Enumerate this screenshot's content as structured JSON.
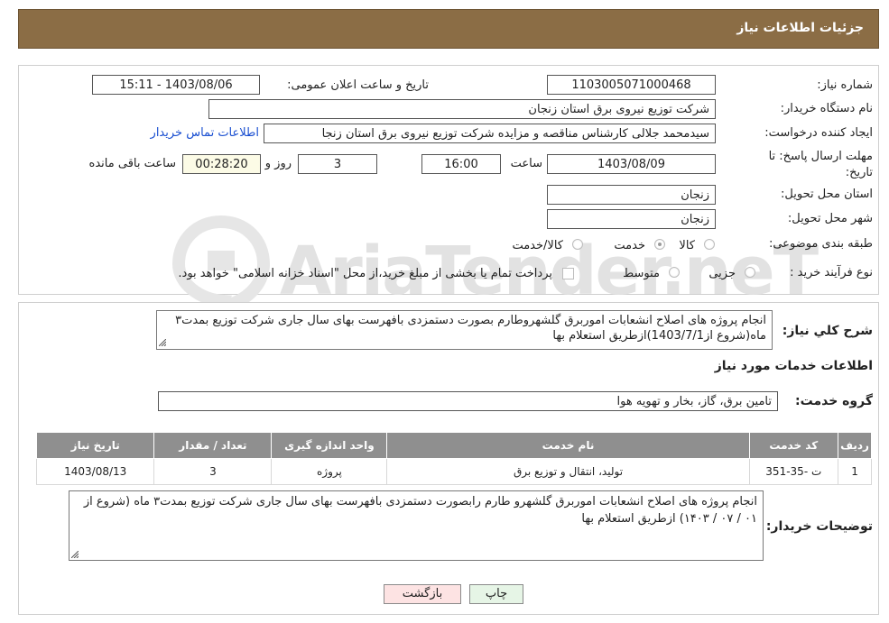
{
  "header": {
    "title": "جزئیات اطلاعات نیاز"
  },
  "fields": {
    "need_number_label": "شماره نیاز:",
    "need_number": "1103005071000468",
    "announce_label": "تاریخ و ساعت اعلان عمومی:",
    "announce_value": "1403/08/06 - 15:11",
    "buyer_org_label": "نام دستگاه خریدار:",
    "buyer_org": "شرکت توزیع نیروی برق استان زنجان",
    "creator_label": "ایجاد کننده درخواست:",
    "creator": "سیدمحمد جلالی کارشناس مناقصه و مزایده شرکت توزیع نیروی برق استان زنجا",
    "contact_link": "اطلاعات تماس خریدار",
    "deadline_label_1": "مهلت ارسال پاسخ: تا",
    "deadline_label_2": "تاریخ:",
    "deadline_date": "1403/08/09",
    "time_label": "ساعت",
    "deadline_time": "16:00",
    "days": "3",
    "days_label": "روز و",
    "remaining": "00:28:20",
    "remaining_label": "ساعت باقی مانده",
    "province_label": "استان محل تحویل:",
    "province": "زنجان",
    "city_label": "شهر محل تحویل:",
    "city": "زنجان",
    "category_label": "طبقه بندی موضوعی:",
    "category_options": [
      "کالا",
      "خدمت",
      "کالا/خدمت"
    ],
    "category_selected": "خدمت",
    "process_label": "نوع فرآیند خرید :",
    "process_options": [
      "جزیی",
      "متوسط"
    ],
    "process_note": "پرداخت تمام یا بخشی از مبلغ خرید،از محل \"اسناد خزانه اسلامی\" خواهد بود."
  },
  "watermark": {
    "text": "AriaTender.neT"
  },
  "description": {
    "label": "شرح کلي نياز:",
    "text": "انجام پروژه های اصلاح انشعابات اموربرق گلشهروطارم بصورت دستمزدی بافهرست بهای سال جاری شرکت توزیع بمدت۳ ماه(شروع از1403/7/1)ازطریق استعلام بها"
  },
  "services": {
    "section_title": "اطلاعات خدمات مورد نیاز",
    "group_label": "گروه خدمت:",
    "group_value": "تامین برق، گاز، بخار و تهویه هوا",
    "table": {
      "columns": [
        "ردیف",
        "کد خدمت",
        "نام خدمت",
        "واحد اندازه گیری",
        "تعداد / مقدار",
        "تاریخ نیاز"
      ],
      "rows": [
        [
          "1",
          "ت -35-351",
          "تولید، انتقال و توزیع برق",
          "پروژه",
          "3",
          "1403/08/13"
        ]
      ]
    }
  },
  "buyer_notes": {
    "label": "توضیحات خریدار:",
    "text": "انجام پروژه های اصلاح انشعابات اموربرق گلشهرو طارم رابصورت دستمزدی بافهرست بهای سال جاری شرکت توزیع بمدت۳ ماه (شروع از ۰۱ / ۰۷ / ۱۴۰۳) ازطریق استعلام بها"
  },
  "buttons": {
    "print": "چاپ",
    "back": "بازگشت"
  },
  "colors": {
    "header_bg": "#8b6d45",
    "table_header_bg": "#8f8f8f",
    "link": "#1a4fd1",
    "back_button_bg": "#fde3e3",
    "print_button_bg": "#e6f5e6"
  }
}
